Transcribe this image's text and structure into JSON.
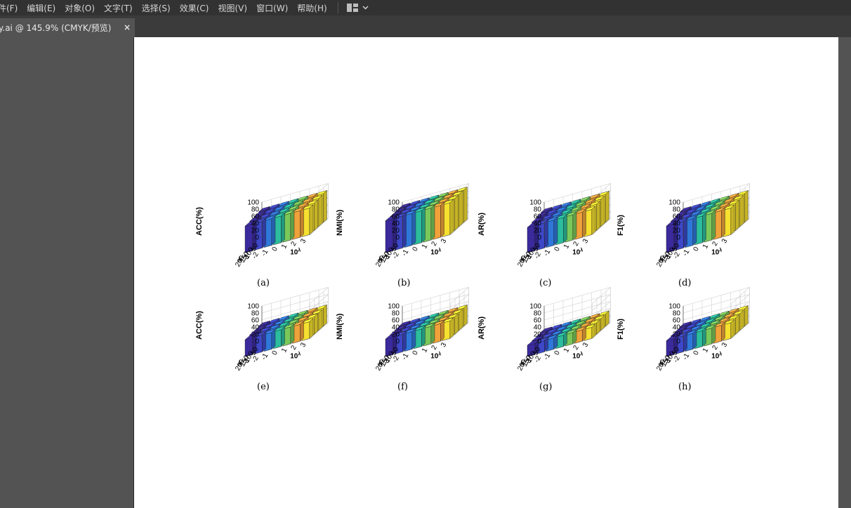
{
  "menu": {
    "items": [
      "件(F)",
      "编辑(E)",
      "对象(O)",
      "文字(T)",
      "选择(S)",
      "效果(C)",
      "视图(V)",
      "窗口(W)",
      "帮助(H)"
    ],
    "workspace_icon": "workspace-layout-icon",
    "chevron_icon": "chevron-down-icon"
  },
  "document_tab": {
    "title": "y.ai @ 145.9% (CMYK/预览)",
    "close_label": "×"
  },
  "colors": {
    "menubar": "#323232",
    "tabbar": "#3b3b3b",
    "workspace": "#535353",
    "artboard": "#ffffff",
    "bar_ramp": [
      "#3a2a9c",
      "#3d47c8",
      "#2f78d9",
      "#24a4c9",
      "#2bbd9d",
      "#7bc85a",
      "#f0a23a",
      "#f6e030"
    ]
  },
  "figure": {
    "y_ticks": [
      "100",
      "80",
      "60",
      "40",
      "20",
      "0"
    ],
    "k_ticks": [
      "50",
      "100",
      "150",
      "200"
    ],
    "k_label": "k",
    "lambda_ticks": [
      "-3",
      "-2",
      "-1",
      "0",
      "1",
      "2",
      "3"
    ],
    "lambda_label": "10",
    "lambda_sup": "λ"
  },
  "chart_data": [
    {
      "type": "bar",
      "caption": "(a)",
      "ylabel": "ACC(%)",
      "ylim": [
        0,
        100
      ],
      "x": [
        "-3",
        "-2",
        "-1",
        "0",
        "1",
        "2",
        "3"
      ],
      "series_axis": "k",
      "series": [
        {
          "name": "50",
          "values": [
            82,
            82,
            82,
            82,
            82,
            82,
            82
          ]
        },
        {
          "name": "100",
          "values": [
            80,
            80,
            80,
            80,
            80,
            80,
            80
          ]
        },
        {
          "name": "150",
          "values": [
            78,
            78,
            78,
            78,
            78,
            78,
            78
          ]
        },
        {
          "name": "200",
          "values": [
            76,
            76,
            76,
            76,
            76,
            76,
            76
          ]
        }
      ]
    },
    {
      "type": "bar",
      "caption": "(b)",
      "ylabel": "NMI(%)",
      "ylim": [
        0,
        100
      ],
      "x": [
        "-3",
        "-2",
        "-1",
        "0",
        "1",
        "2",
        "3"
      ],
      "series_axis": "k",
      "series": [
        {
          "name": "50",
          "values": [
            92,
            92,
            92,
            92,
            92,
            92,
            92
          ]
        },
        {
          "name": "100",
          "values": [
            92,
            92,
            92,
            92,
            92,
            92,
            92
          ]
        },
        {
          "name": "150",
          "values": [
            91,
            91,
            91,
            91,
            91,
            91,
            91
          ]
        },
        {
          "name": "200",
          "values": [
            91,
            91,
            91,
            91,
            91,
            91,
            91
          ]
        }
      ]
    },
    {
      "type": "bar",
      "caption": "(c)",
      "ylabel": "AR(%)",
      "ylim": [
        0,
        100
      ],
      "x": [
        "-3",
        "-2",
        "-1",
        "0",
        "1",
        "2",
        "3"
      ],
      "series_axis": "k",
      "series": [
        {
          "name": "50",
          "values": [
            80,
            80,
            80,
            80,
            80,
            80,
            80
          ]
        },
        {
          "name": "100",
          "values": [
            78,
            78,
            78,
            78,
            78,
            78,
            78
          ]
        },
        {
          "name": "150",
          "values": [
            75,
            75,
            75,
            75,
            75,
            75,
            75
          ]
        },
        {
          "name": "200",
          "values": [
            72,
            72,
            72,
            72,
            72,
            72,
            72
          ]
        }
      ]
    },
    {
      "type": "bar",
      "caption": "(d)",
      "ylabel": "F1(%)",
      "ylim": [
        0,
        100
      ],
      "x": [
        "-3",
        "-2",
        "-1",
        "0",
        "1",
        "2",
        "3"
      ],
      "series_axis": "k",
      "series": [
        {
          "name": "50",
          "values": [
            82,
            82,
            82,
            82,
            82,
            82,
            82
          ]
        },
        {
          "name": "100",
          "values": [
            80,
            80,
            80,
            80,
            80,
            80,
            80
          ]
        },
        {
          "name": "150",
          "values": [
            78,
            78,
            78,
            78,
            78,
            78,
            78
          ]
        },
        {
          "name": "200",
          "values": [
            76,
            76,
            76,
            76,
            76,
            76,
            76
          ]
        }
      ]
    },
    {
      "type": "bar",
      "caption": "(e)",
      "ylabel": "ACC(%)",
      "ylim": [
        0,
        100
      ],
      "x": [
        "-3",
        "-2",
        "-1",
        "0",
        "1",
        "2",
        "3"
      ],
      "series_axis": "k",
      "series": [
        {
          "name": "50",
          "values": [
            52,
            52,
            52,
            52,
            52,
            52,
            52
          ]
        },
        {
          "name": "100",
          "values": [
            50,
            50,
            50,
            50,
            50,
            50,
            50
          ]
        },
        {
          "name": "150",
          "values": [
            50,
            50,
            50,
            50,
            50,
            50,
            50
          ]
        },
        {
          "name": "200",
          "values": [
            48,
            48,
            48,
            48,
            48,
            48,
            48
          ]
        }
      ]
    },
    {
      "type": "bar",
      "caption": "(f)",
      "ylabel": "NMI(%)",
      "ylim": [
        0,
        100
      ],
      "x": [
        "-3",
        "-2",
        "-1",
        "0",
        "1",
        "2",
        "3"
      ],
      "series_axis": "k",
      "series": [
        {
          "name": "50",
          "values": [
            52,
            52,
            52,
            52,
            52,
            52,
            52
          ]
        },
        {
          "name": "100",
          "values": [
            51,
            51,
            51,
            51,
            51,
            51,
            51
          ]
        },
        {
          "name": "150",
          "values": [
            50,
            50,
            50,
            50,
            50,
            50,
            50
          ]
        },
        {
          "name": "200",
          "values": [
            50,
            50,
            50,
            50,
            50,
            50,
            50
          ]
        }
      ]
    },
    {
      "type": "bar",
      "caption": "(g)",
      "ylabel": "AR(%)",
      "ylim": [
        0,
        100
      ],
      "x": [
        "-3",
        "-2",
        "-1",
        "0",
        "1",
        "2",
        "3"
      ],
      "series_axis": "k",
      "series": [
        {
          "name": "50",
          "values": [
            35,
            35,
            35,
            35,
            35,
            35,
            35
          ]
        },
        {
          "name": "100",
          "values": [
            34,
            34,
            34,
            34,
            34,
            34,
            34
          ]
        },
        {
          "name": "150",
          "values": [
            33,
            33,
            33,
            33,
            33,
            33,
            33
          ]
        },
        {
          "name": "200",
          "values": [
            32,
            32,
            32,
            32,
            32,
            32,
            32
          ]
        }
      ]
    },
    {
      "type": "bar",
      "caption": "(h)",
      "ylabel": "F1(%)",
      "ylim": [
        0,
        100
      ],
      "x": [
        "-3",
        "-2",
        "-1",
        "0",
        "1",
        "2",
        "3"
      ],
      "series_axis": "k",
      "series": [
        {
          "name": "50",
          "values": [
            50,
            50,
            50,
            50,
            50,
            50,
            50
          ]
        },
        {
          "name": "100",
          "values": [
            48,
            48,
            48,
            48,
            48,
            48,
            48
          ]
        },
        {
          "name": "150",
          "values": [
            47,
            47,
            47,
            47,
            47,
            47,
            47
          ]
        },
        {
          "name": "200",
          "values": [
            45,
            45,
            45,
            45,
            45,
            45,
            45
          ]
        }
      ]
    }
  ]
}
